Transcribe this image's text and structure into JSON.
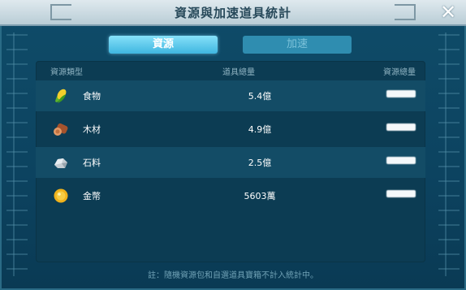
{
  "window": {
    "title": "資源與加速道具統計"
  },
  "tabs": [
    {
      "label": "資源",
      "active": true
    },
    {
      "label": "加速",
      "active": false
    }
  ],
  "table": {
    "headers": {
      "type": "資源類型",
      "total": "道具總量",
      "resource_total": "資源總量"
    },
    "rows": [
      {
        "icon": "corn-icon",
        "name": "食物",
        "total": "5.4億",
        "resource_total": ""
      },
      {
        "icon": "wood-log-icon",
        "name": "木材",
        "total": "4.9億",
        "resource_total": ""
      },
      {
        "icon": "stone-icon",
        "name": "石料",
        "total": "2.5億",
        "resource_total": ""
      },
      {
        "icon": "gold-coin-icon",
        "name": "金幣",
        "total": "5603萬",
        "resource_total": ""
      }
    ]
  },
  "footer": {
    "note": "註：隨機資源包和自選道具寶箱不計入統計中。"
  },
  "colors": {
    "background": "#0c4360",
    "active_tab": "#3fb6e0",
    "inactive_tab": "#2f8db0",
    "row_stripe": "#134c66"
  }
}
